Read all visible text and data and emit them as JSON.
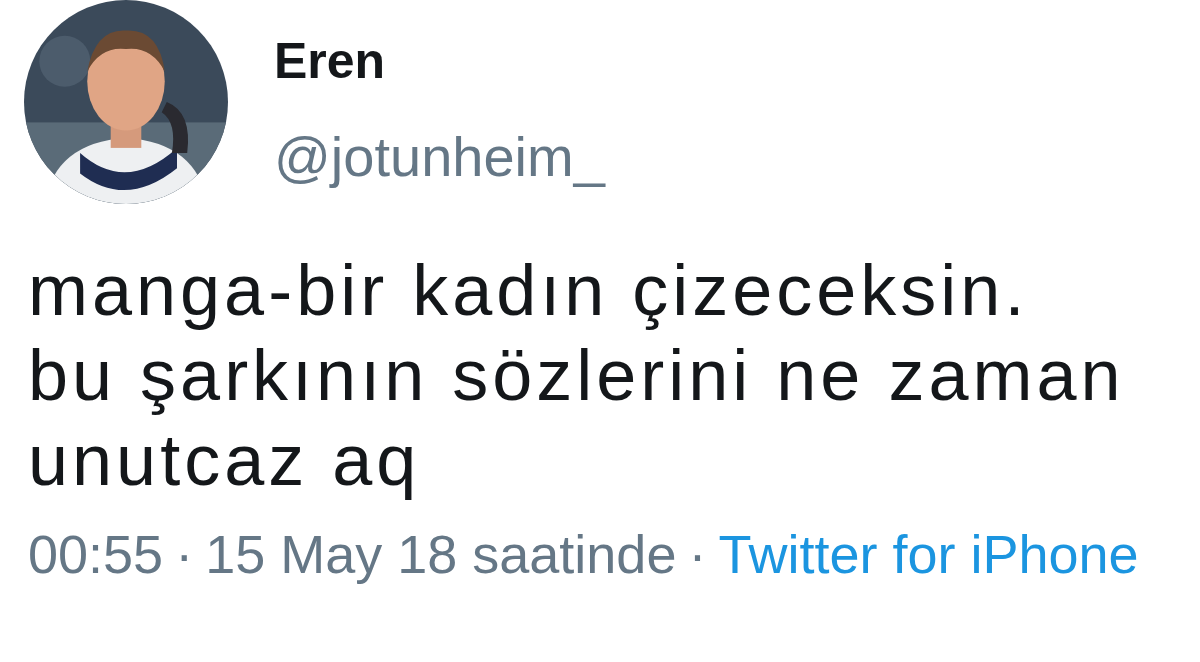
{
  "user": {
    "name": "Eren",
    "handle": "@jotunheim_"
  },
  "tweet": {
    "lines": [
      "manga-bir kadın çizeceksin.",
      "bu şarkının sözlerini ne zaman",
      "unutcaz aq"
    ]
  },
  "footer": [
    {
      "kind": "time",
      "text": "00:55"
    },
    {
      "kind": "separator",
      "text": "·"
    },
    {
      "kind": "date",
      "text": "15 May 18 saatinde"
    },
    {
      "kind": "separator",
      "text": "·"
    },
    {
      "kind": "link",
      "text": "Twitter for iPhone"
    }
  ]
}
